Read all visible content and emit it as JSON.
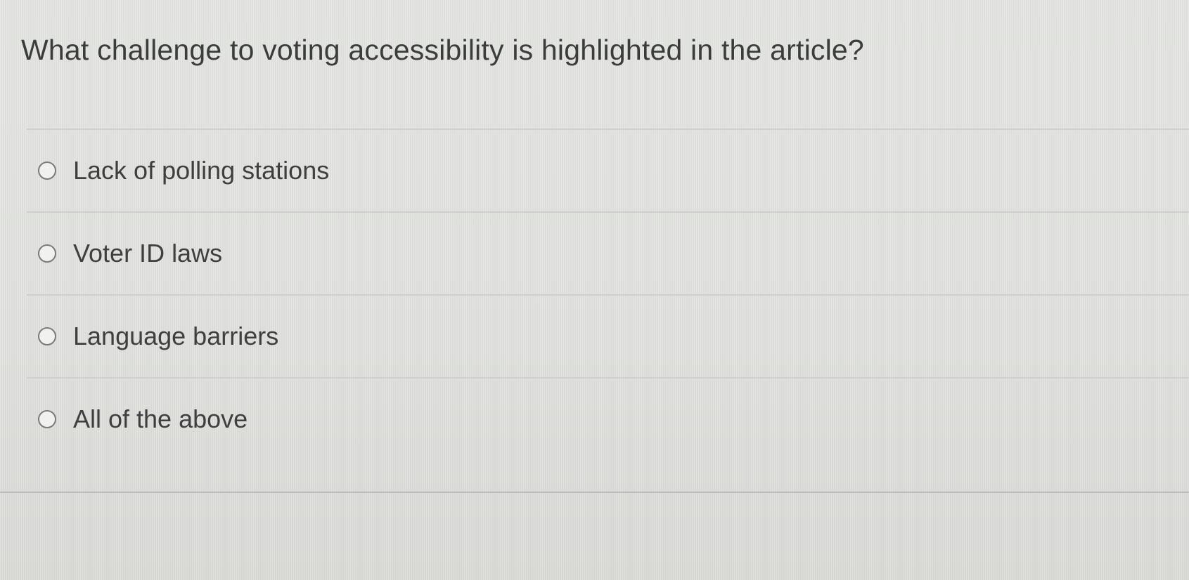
{
  "question": {
    "text": "What challenge to voting accessibility is highlighted in the article?"
  },
  "options": [
    {
      "label": "Lack of polling stations",
      "selected": false
    },
    {
      "label": "Voter ID laws",
      "selected": false
    },
    {
      "label": "Language barriers",
      "selected": false
    },
    {
      "label": "All of the above",
      "selected": false
    }
  ]
}
